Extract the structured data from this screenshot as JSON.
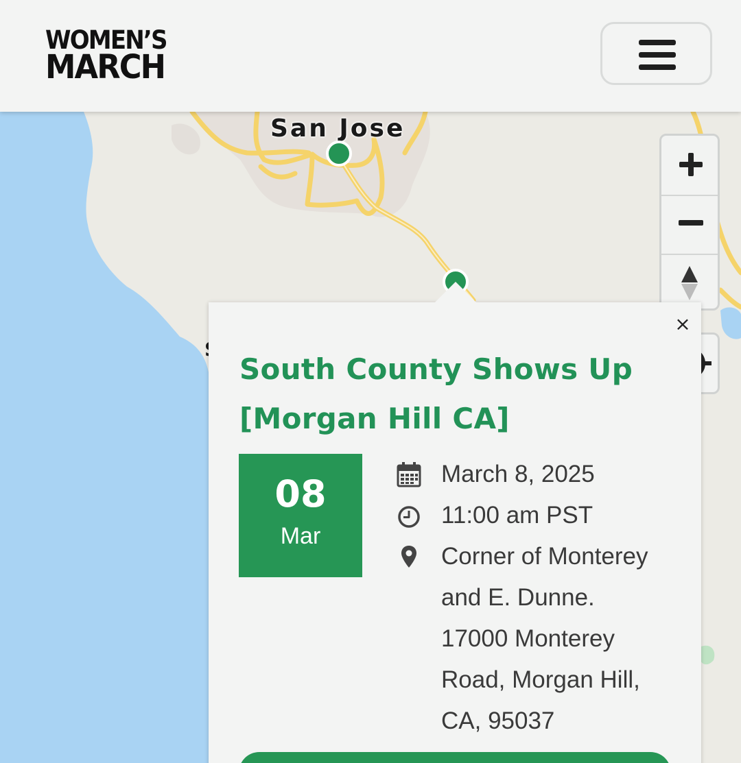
{
  "header": {
    "logo_line1": "WOMEN’S",
    "logo_line2": "MARCH"
  },
  "icons": {
    "menu": "hamburger-menu-icon",
    "zoom_in": "plus-icon",
    "zoom_out": "minus-icon",
    "compass": "compass-icon",
    "geolocate": "crosshair-target-icon",
    "close": "close-icon",
    "calendar": "calendar-icon",
    "clock": "clock-icon",
    "location": "map-pin-icon"
  },
  "map": {
    "city_label": "San Jose",
    "colors": {
      "water": "#a9d3f3",
      "land": "#ecebe5",
      "urban": "#e6e1dc",
      "road": "#f5d36a",
      "marker": "#249455"
    }
  },
  "popup": {
    "close_label": "×",
    "title": "South County Shows Up [Morgan Hill CA]",
    "date_day": "08",
    "date_month": "Mar",
    "date_full": "March 8, 2025",
    "time": "11:00 am PST",
    "location_lines": [
      "Corner of Monterey",
      "and E. Dunne.",
      "17000 Monterey",
      "Road, Morgan Hill,",
      "CA, 95037"
    ]
  },
  "colors": {
    "brand_green": "#269655",
    "title_green": "#229257",
    "text": "#3a3a3a"
  }
}
